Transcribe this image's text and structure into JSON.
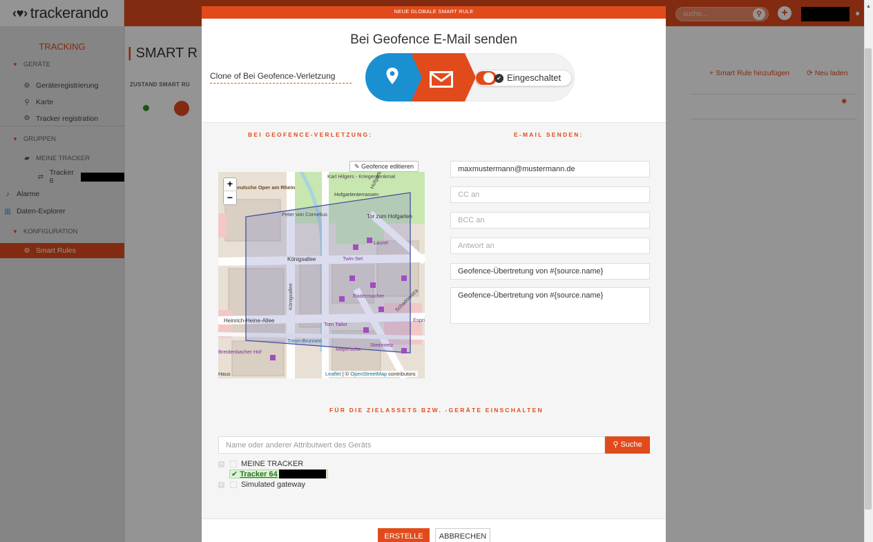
{
  "app": {
    "logo_text": "trackerando",
    "search_placeholder": "suche...",
    "colors": {
      "accent": "#e14b1c",
      "step_blue": "#1b90d1",
      "success": "#3a8a2d"
    }
  },
  "sidebar": {
    "tracking": "TRACKING",
    "sections": {
      "geraete": "GERÄTE",
      "gruppen": "GRUPPEN",
      "konfiguration": "KONFIGURATION"
    },
    "items": {
      "geraeteregistrierung": "Geräteregistrierung",
      "karte": "Karte",
      "tracker_registration": "Tracker registration",
      "meine_tracker": "MEINE TRACKER",
      "tracker_6": "Tracker 6",
      "alarme": "Alarme",
      "daten_explorer": "Daten-Explorer",
      "smart_rules": "Smart Rules"
    }
  },
  "main": {
    "page_title": "SMART R",
    "table_headers": "ZUSTAND   SMART RU",
    "add_rule": "Smart Rule hinzufügen",
    "reload": "Neu laden"
  },
  "modal": {
    "header": "NEUE GLOBALE SMART RULE",
    "title": "Bei Geofence E-Mail senden",
    "rule_name": "Clone of Bei Geofence-Verletzung",
    "toggle_label": "Eingeschaltet",
    "left_section_title": "BEI GEOFENCE-VERLETZUNG:",
    "right_section_title": "E-MAIL SENDEN:",
    "geofence_edit": "Geofence editieren",
    "zoom_in": "+",
    "zoom_out": "−",
    "map_attribution": {
      "leaflet": "Leaflet",
      "sep": " | © ",
      "osm": "OpenStreetMap",
      "contributors": " contributors"
    },
    "map_labels": {
      "deutsche_oper": "Deutsche Oper am Rhein",
      "karl_hilgers": "Karl Hilgers - Kriegerdenkmal",
      "hofgartenterrassen": "Hofgartenterrassen",
      "peter_von_cornelius": "Peter von Cornelius",
      "tor_zum_hofgarten": "Tor zum Hofgarten",
      "koenigsallee": "Königsallee",
      "twin_set": "Twin-Set",
      "laurel": "Laurel",
      "radermacher": "Radermacher",
      "heinrich_heine_allee": "Heinrich-Heine-Allee",
      "tom_tailor": "Tom Tailor",
      "triton_brunnen": "Triton-Brunnen",
      "mayersche": "Mayersche",
      "steinmetz": "Steinmetz",
      "breidenbacher_hof": "Breidenbacher Hof",
      "esprit": "Espri",
      "haus": "Haus",
      "hofgarte": "Hofgarte",
      "koenigsallee_v": "Königsallee",
      "schadowstr": "Schadowstra"
    },
    "email": {
      "to": "maxmustermann@mustermann.de",
      "cc_placeholder": "CC an",
      "bcc_placeholder": "BCC an",
      "reply_placeholder": "Antwort an",
      "subject": "Geofence-Übertretung von #{source.name}",
      "body": "Geofence-Übertretung von #{source.name}"
    },
    "devices_section_title": "FÜR DIE ZIELASSETS BZW. -GERÄTE EINSCHALTEN",
    "device_search_placeholder": "Name oder anderer Attributwert des Geräts",
    "device_search_button": "Suche",
    "tree": {
      "meine_tracker": "MEINE TRACKER",
      "tracker_selected": "Tracker 64",
      "simulated_gateway": "Simulated gateway"
    },
    "buttons": {
      "create": "ERSTELLE",
      "cancel": "ABBRECHEN"
    }
  }
}
